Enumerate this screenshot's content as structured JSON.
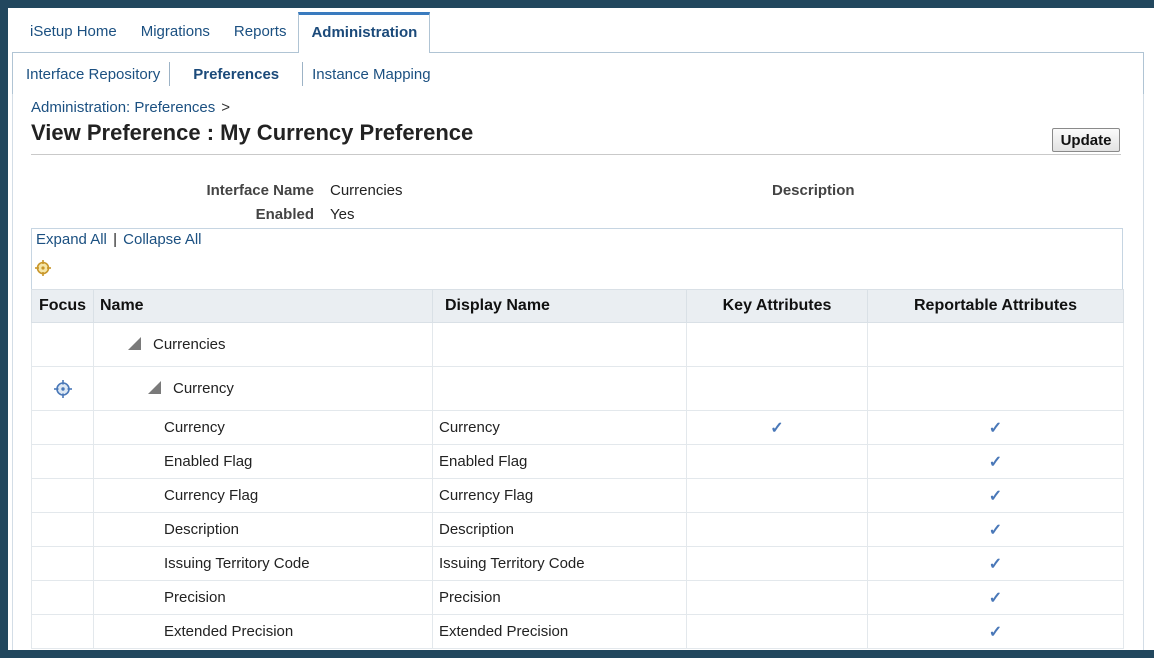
{
  "tabs": [
    {
      "label": "iSetup Home",
      "active": false
    },
    {
      "label": "Migrations",
      "active": false
    },
    {
      "label": "Reports",
      "active": false
    },
    {
      "label": "Administration",
      "active": true
    }
  ],
  "subnav": [
    {
      "label": "Interface Repository",
      "active": false
    },
    {
      "label": "Preferences",
      "active": true
    },
    {
      "label": "Instance Mapping",
      "active": false
    }
  ],
  "breadcrumb": {
    "link": "Administration: Preferences",
    "separator": ">"
  },
  "page_title": "View Preference : My Currency Preference",
  "update_label": "Update",
  "details": {
    "interface_name_label": "Interface Name",
    "interface_name_value": "Currencies",
    "enabled_label": "Enabled",
    "enabled_value": "Yes",
    "description_label": "Description"
  },
  "tree_toolbar": {
    "expand_all": "Expand All",
    "separator": "|",
    "collapse_all": "Collapse All"
  },
  "table": {
    "headers": [
      "Focus",
      "Name",
      "Display Name",
      "Key Attributes",
      "Reportable Attributes"
    ],
    "nodes": [
      {
        "name": "Currencies"
      },
      {
        "name": "Currency"
      }
    ],
    "rows": [
      {
        "name": "Currency",
        "display": "Currency",
        "key": true,
        "reportable": true
      },
      {
        "name": "Enabled Flag",
        "display": "Enabled Flag",
        "key": false,
        "reportable": true
      },
      {
        "name": "Currency Flag",
        "display": "Currency Flag",
        "key": false,
        "reportable": true
      },
      {
        "name": "Description",
        "display": "Description",
        "key": false,
        "reportable": true
      },
      {
        "name": "Issuing Territory Code",
        "display": "Issuing Territory Code",
        "key": false,
        "reportable": true
      },
      {
        "name": "Precision",
        "display": "Precision",
        "key": false,
        "reportable": true
      },
      {
        "name": "Extended Precision",
        "display": "Extended Precision",
        "key": false,
        "reportable": true
      }
    ]
  },
  "check_glyph": "✓",
  "colors": {
    "accent": "#1b5081",
    "frame": "#22475e",
    "check": "#4a78b8",
    "header_bg": "#eaeef2"
  },
  "icons": {
    "focus": "focus-crosshair-icon",
    "expand_node": "triangle-expanded-icon",
    "check": "checkmark-icon"
  }
}
